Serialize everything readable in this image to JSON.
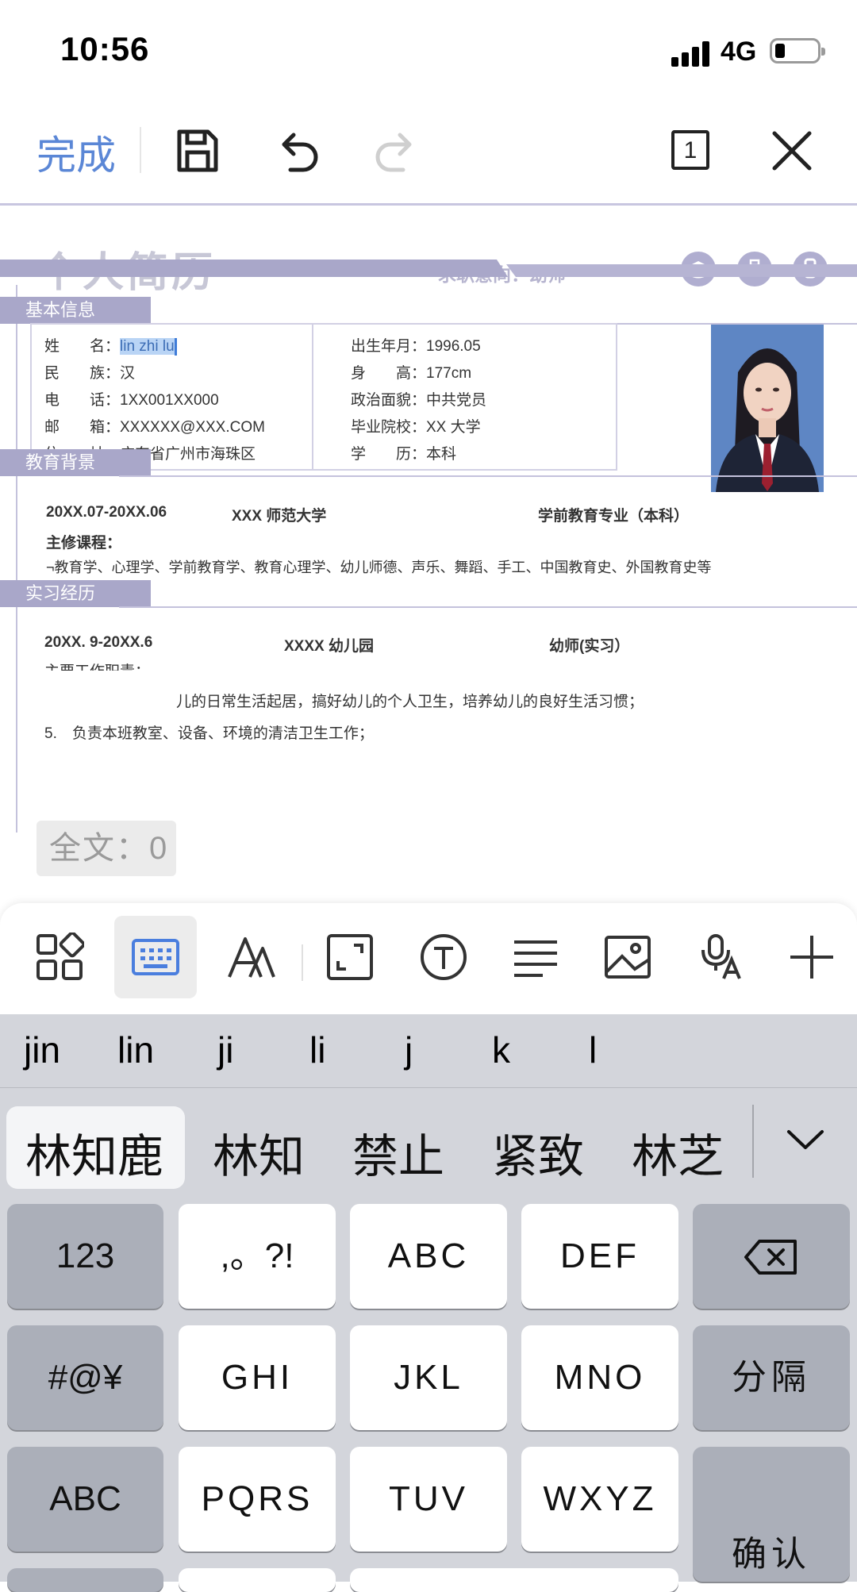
{
  "status_bar": {
    "time": "10:56",
    "network": "4G"
  },
  "toolbar": {
    "done_label": "完成",
    "page_count": "1"
  },
  "document": {
    "title": "个人简历",
    "job_intent": "求职意向：幼师",
    "sections": {
      "basic": "基本信息",
      "education": "教育背景",
      "internship": "实习经历"
    },
    "basic_info": {
      "name_label": "姓　　名：",
      "name_value": "lin zhi lu",
      "ethnicity": "民　　族：汉",
      "phone": "电　　话：1XX001XX000",
      "email": "邮　　箱：XXXXXX@XXX.COM",
      "address": "住　　址：广东省广州市海珠区",
      "birth": "出生年月：1996.05",
      "height": "身　　高：177cm",
      "political": "政治面貌：中共党员",
      "school": "毕业院校：XX 大学",
      "degree": "学　　历：本科"
    },
    "education": {
      "period": "20XX.07-20XX.06",
      "school": "XXX 师范大学",
      "major": "学前教育专业（本科）",
      "courses_label": "主修课程：",
      "courses": "¬教育学、心理学、学前教育学、教育心理学、幼儿师德、声乐、舞蹈、手工、中国教育史、外国教育史等"
    },
    "internship": {
      "period": "20XX. 9-20XX.6",
      "org": "XXXX 幼儿园",
      "role": "幼师(实习）",
      "duties_label": "主要工作职责：",
      "duty_line_partial": "儿的日常生活起居，搞好幼儿的个人卫生，培养幼儿的良好生活习惯；",
      "duty_5": "5.　负责本班教室、设备、环境的清洁卫生工作；"
    },
    "word_count": "全文：0"
  },
  "format_bar": {
    "icons": [
      "grid-icon",
      "keyboard-icon",
      "text-style-icon",
      "resize-icon",
      "text-box-icon",
      "align-icon",
      "image-icon",
      "dictation-icon",
      "add-icon"
    ],
    "active": "keyboard-icon"
  },
  "keyboard": {
    "pinyin_options": [
      "jin",
      "lin",
      "ji",
      "li",
      "j",
      "k",
      "l"
    ],
    "candidates": [
      "林知鹿",
      "林知",
      "禁止",
      "紧致",
      "林芝"
    ],
    "keys": {
      "num": "123",
      "punct": ",。?!",
      "abc_key": "ABC",
      "def": "DEF",
      "symbols": "#@¥",
      "ghi": "GHI",
      "jkl": "JKL",
      "mno": "MNO",
      "separator": "分隔",
      "abc_switch": "ABC",
      "pqrs": "PQRS",
      "tuv": "TUV",
      "wxyz": "WXYZ",
      "confirm": "确认"
    }
  },
  "colors": {
    "accent_blue": "#5b87d6",
    "resume_purple": "#a9a7c9",
    "keyboard_bg": "#d3d5db"
  }
}
